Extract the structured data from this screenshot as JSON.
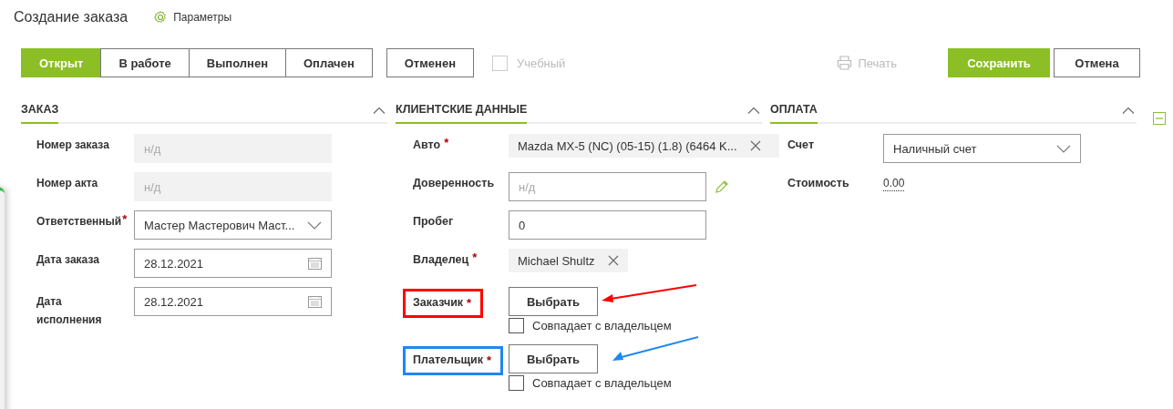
{
  "header": {
    "title": "Создание заказа",
    "settings_link": "Параметры"
  },
  "statuses": [
    {
      "label": "Открыт",
      "selected": true
    },
    {
      "label": "В работе",
      "selected": false
    },
    {
      "label": "Выполнен",
      "selected": false
    },
    {
      "label": "Оплачен",
      "selected": false
    },
    {
      "label": "Отменен",
      "selected": false
    }
  ],
  "training": {
    "label": "Учебный",
    "checked": false,
    "disabled": true
  },
  "print": {
    "label": "Печать",
    "disabled": true
  },
  "actions": {
    "save": "Сохранить",
    "cancel": "Отмена"
  },
  "order": {
    "title": "ЗАКАЗ",
    "fields": [
      {
        "kind": "readonly",
        "label": "Номер заказа",
        "placeholder": "н/д"
      },
      {
        "kind": "readonly",
        "label": "Номер акта",
        "placeholder": "н/д"
      },
      {
        "kind": "select",
        "label": "Ответственный",
        "required_mark": "*",
        "value": "Мастер Мастерович Маст..."
      },
      {
        "kind": "date",
        "label": "Дата заказа",
        "value": "28.12.2021"
      },
      {
        "kind": "date",
        "label": "Дата исполнения",
        "value": "28.12.2021"
      }
    ]
  },
  "client": {
    "title": "КЛИЕНТСКИЕ ДАННЫЕ",
    "fields": [
      {
        "kind": "tag",
        "label": "Авто",
        "required_mark": "*",
        "value": "Mazda MX-5 (NC) (05-15) (1.8) (6464 K..."
      },
      {
        "kind": "input",
        "label": "Доверенность",
        "placeholder": "н/д",
        "editable": true
      },
      {
        "kind": "input",
        "label": "Пробег",
        "value": "0"
      },
      {
        "kind": "tag",
        "label": "Владелец",
        "required_mark": "*",
        "value": "Michael Shultz"
      },
      {
        "kind": "choose",
        "label": "Заказчик",
        "required_mark": "*",
        "button": "Выбрать",
        "checkbox": "Совпадает с владельцем",
        "checked": false,
        "color": "#ff0000"
      },
      {
        "kind": "choose",
        "label": "Плательщик",
        "required_mark": "*",
        "button": "Выбрать",
        "checkbox": "Совпадает с владельцем",
        "checked": false,
        "color": "#1e88f0"
      }
    ]
  },
  "payment": {
    "title": "ОПЛАТА",
    "fields": [
      {
        "kind": "select",
        "label": "Счет",
        "value": "Наличный счет"
      },
      {
        "kind": "value",
        "label": "Стоимость",
        "value": "0.00"
      }
    ]
  }
}
